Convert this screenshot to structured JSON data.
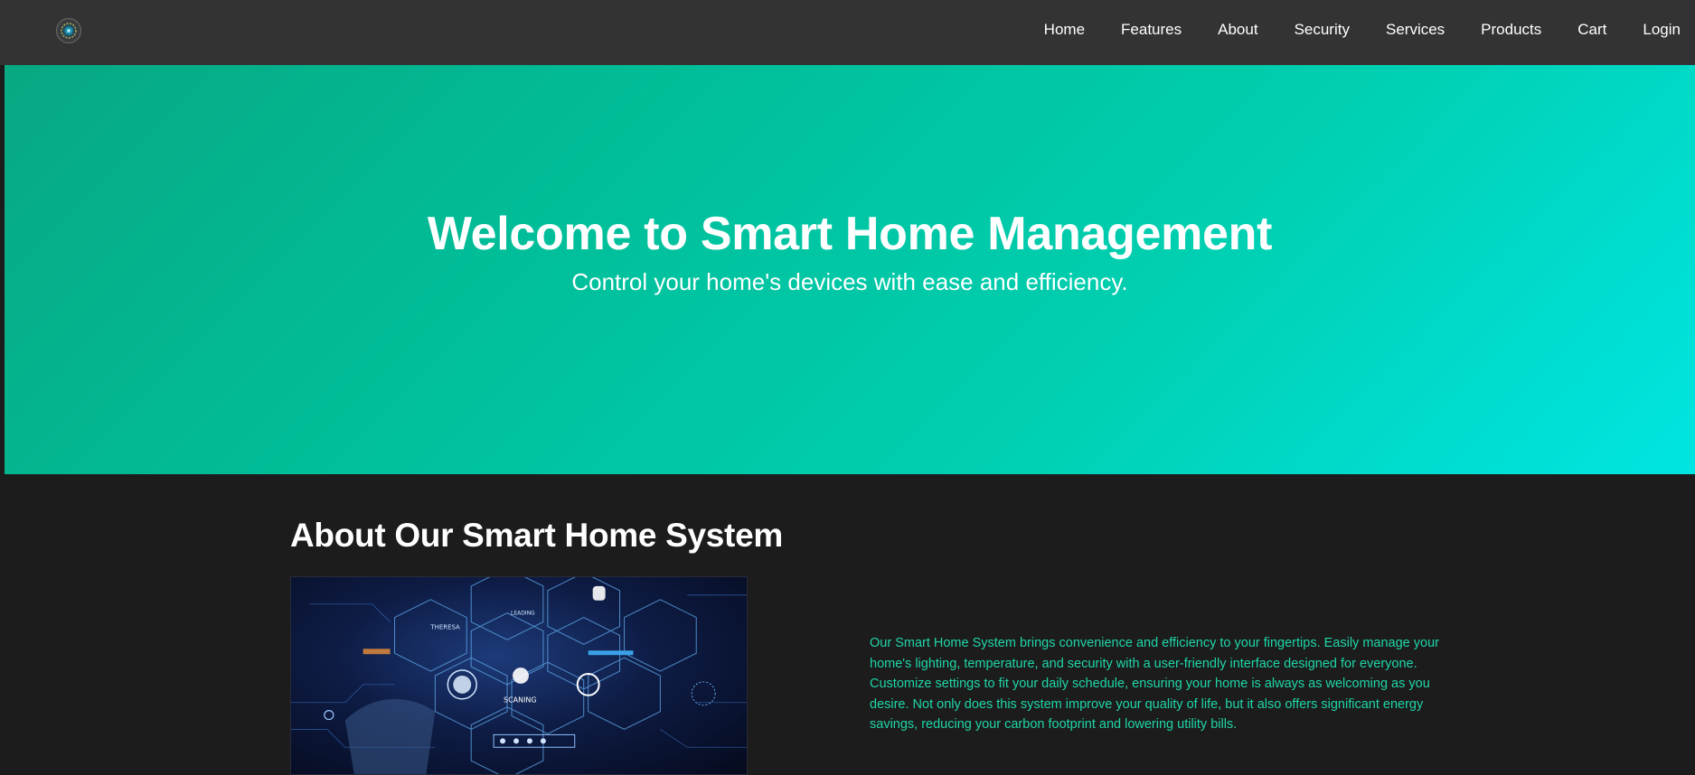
{
  "navbar": {
    "logo_icon": "gear-circuit-logo-icon",
    "links": [
      {
        "label": "Home"
      },
      {
        "label": "Features"
      },
      {
        "label": "About"
      },
      {
        "label": "Security"
      },
      {
        "label": "Services"
      },
      {
        "label": "Products"
      },
      {
        "label": "Cart"
      },
      {
        "label": "Login"
      }
    ]
  },
  "hero": {
    "title": "Welcome to Smart Home Management",
    "subtitle": "Control your home's devices with ease and efficiency."
  },
  "about": {
    "title": "About Our Smart Home System",
    "image_labels": [
      "THERESA",
      "LEADING",
      "SCANING"
    ],
    "description": "Our Smart Home System brings convenience and efficiency to your fingertips. Easily manage your home's lighting, temperature, and security with a user-friendly interface designed for everyone. Customize settings to fit your daily schedule, ensuring your home is always as welcoming as you desire. Not only does this system improve your quality of life, but it also offers significant energy savings, reducing your carbon footprint and lowering utility bills."
  },
  "colors": {
    "navbar_bg": "#333333",
    "hero_gradient_start": "#07a882",
    "hero_gradient_end": "#00e5e2",
    "page_bg": "#1c1c1c",
    "accent_text": "#1fd6a8"
  }
}
